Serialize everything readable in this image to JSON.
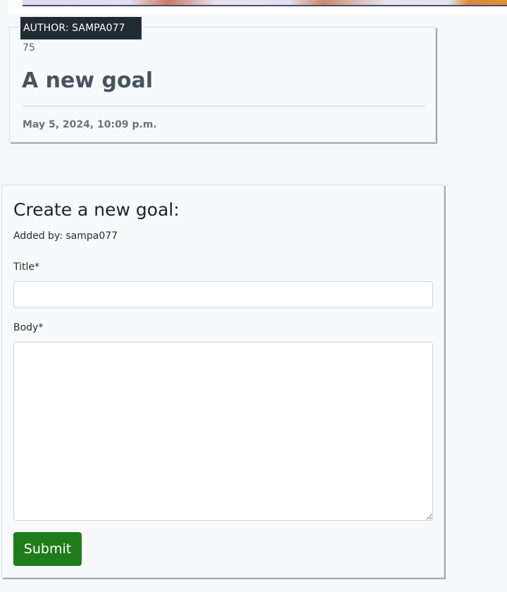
{
  "goal_card": {
    "author_badge": "AUTHOR: SAMPA077",
    "goal_id": "75",
    "title": "A new goal",
    "date": "May 5, 2024, 10:09 p.m."
  },
  "form": {
    "heading": "Create a new goal:",
    "added_by": "Added by: sampa077",
    "title_label": "Title*",
    "title_value": "",
    "body_label": "Body*",
    "body_value": "",
    "submit_label": "Submit"
  },
  "colors": {
    "author_badge_bg": "#1f2c31",
    "submit_bg": "#1e7d1a",
    "goal_title": "#475362"
  }
}
